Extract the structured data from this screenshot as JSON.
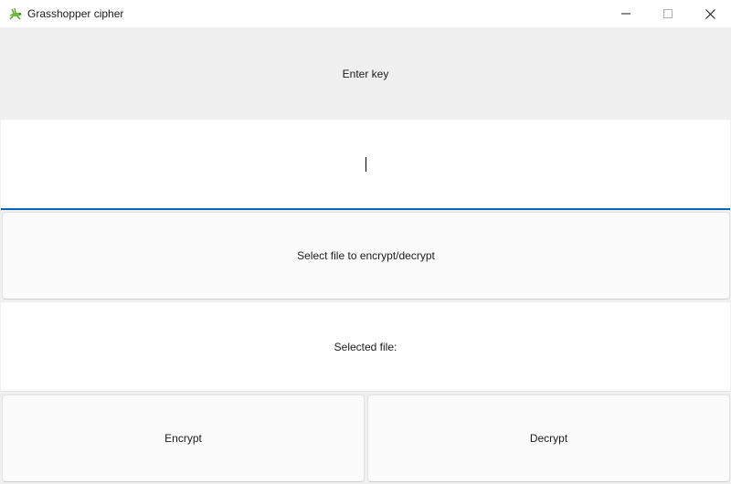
{
  "window": {
    "title": "Grasshopper cipher",
    "icon": "grasshopper-icon",
    "controls": [
      "minimize-icon",
      "maximize-icon",
      "close-icon"
    ]
  },
  "key_section": {
    "label": "Enter key",
    "input_value": "",
    "input_placeholder": ""
  },
  "file_section": {
    "select_button_label": "Select file to encrypt/decrypt",
    "selected_label": "Selected file:"
  },
  "actions": {
    "encrypt_label": "Encrypt",
    "decrypt_label": "Decrypt"
  },
  "colors": {
    "accent": "#0067c0",
    "window_bg": "#f0f0f0",
    "button_bg": "#fbfbfb"
  }
}
